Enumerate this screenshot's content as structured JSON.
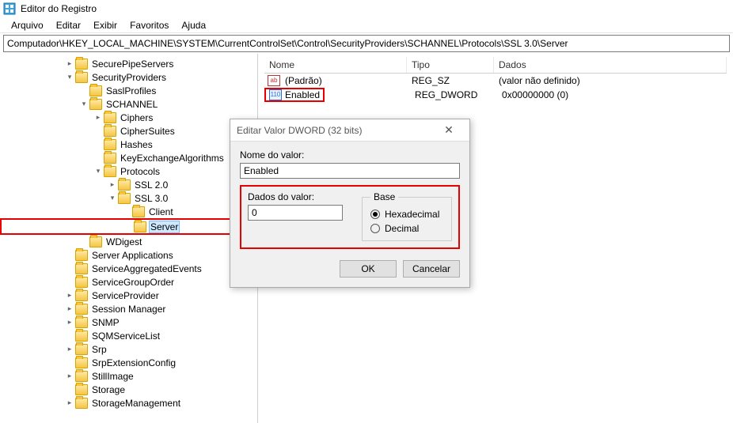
{
  "window": {
    "title": "Editor do Registro"
  },
  "menu": {
    "file": "Arquivo",
    "edit": "Editar",
    "view": "Exibir",
    "favorites": "Favoritos",
    "help": "Ajuda"
  },
  "address": "Computador\\HKEY_LOCAL_MACHINE\\SYSTEM\\CurrentControlSet\\Control\\SecurityProviders\\SCHANNEL\\Protocols\\SSL 3.0\\Server",
  "tree": {
    "items": [
      "SecurePipeServers",
      "SecurityProviders",
      "SaslProfiles",
      "SCHANNEL",
      "Ciphers",
      "CipherSuites",
      "Hashes",
      "KeyExchangeAlgorithms",
      "Protocols",
      "SSL 2.0",
      "SSL 3.0",
      "Client",
      "Server",
      "WDigest",
      "Server Applications",
      "ServiceAggregatedEvents",
      "ServiceGroupOrder",
      "ServiceProvider",
      "Session Manager",
      "SNMP",
      "SQMServiceList",
      "Srp",
      "SrpExtensionConfig",
      "StillImage",
      "Storage",
      "StorageManagement"
    ]
  },
  "list": {
    "headers": {
      "name": "Nome",
      "type": "Tipo",
      "data": "Dados"
    },
    "rows": [
      {
        "name": "(Padrão)",
        "type": "REG_SZ",
        "data": "(valor não definido)"
      },
      {
        "name": "Enabled",
        "type": "REG_DWORD",
        "data": "0x00000000 (0)"
      }
    ]
  },
  "dialog": {
    "title": "Editar Valor DWORD (32 bits)",
    "name_label": "Nome do valor:",
    "name_value": "Enabled",
    "data_label": "Dados do valor:",
    "data_value": "0",
    "base_label": "Base",
    "hex": "Hexadecimal",
    "dec": "Decimal",
    "ok": "OK",
    "cancel": "Cancelar"
  }
}
